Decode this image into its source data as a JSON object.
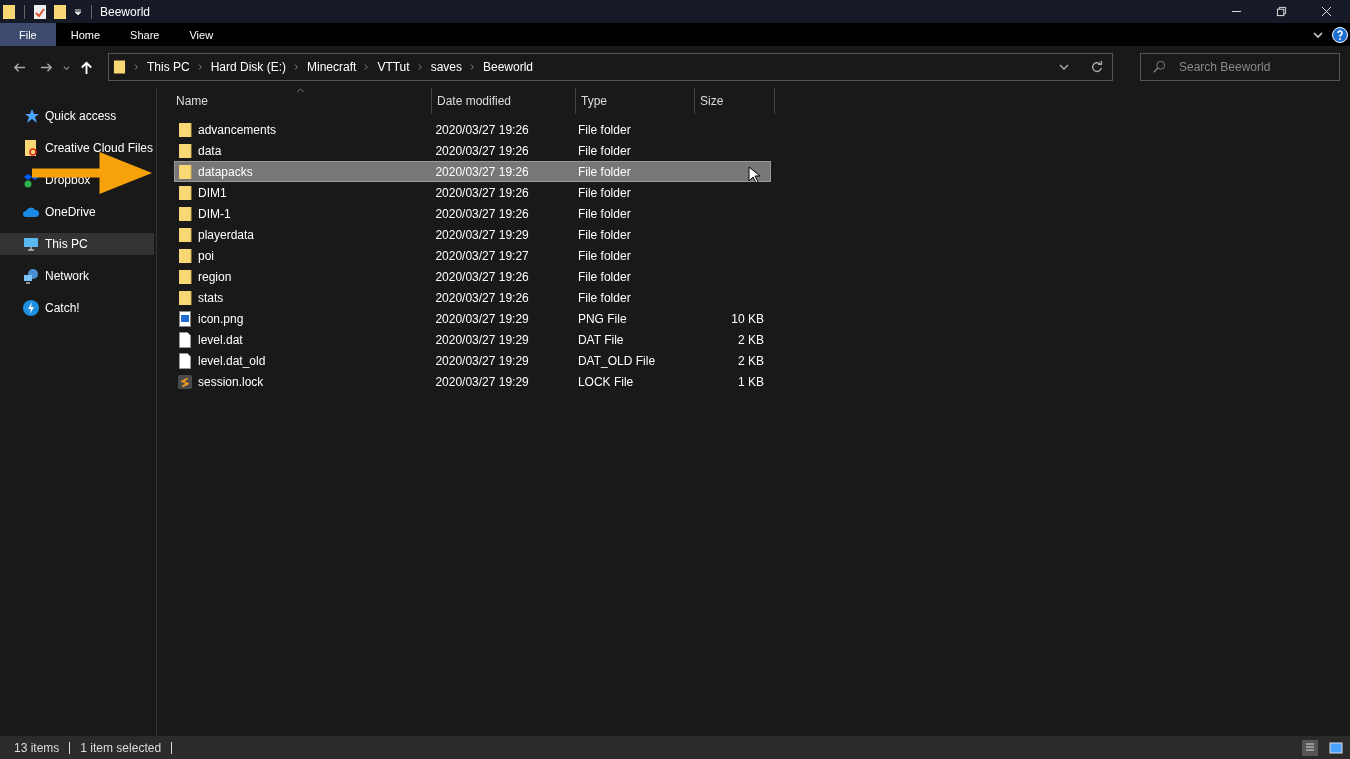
{
  "window": {
    "title": "Beeworld"
  },
  "ribbon_tabs": [
    {
      "label": "File",
      "selected": true
    },
    {
      "label": "Home",
      "selected": false
    },
    {
      "label": "Share",
      "selected": false
    },
    {
      "label": "View",
      "selected": false
    }
  ],
  "address": {
    "crumbs": [
      "This PC",
      "Hard Disk (E:)",
      "Minecraft",
      "VTTut",
      "saves",
      "Beeworld"
    ]
  },
  "search": {
    "placeholder": "Search Beeworld"
  },
  "sidebar": {
    "items": [
      {
        "label": "Quick access",
        "kind": "star",
        "selected": false
      },
      {
        "label": "Creative Cloud Files",
        "kind": "cloud-folder",
        "selected": false
      },
      {
        "label": "Dropbox",
        "kind": "dropbox",
        "selected": false
      },
      {
        "label": "OneDrive",
        "kind": "onedrive",
        "selected": false
      },
      {
        "label": "This PC",
        "kind": "pc",
        "selected": true
      },
      {
        "label": "Network",
        "kind": "network",
        "selected": false
      },
      {
        "label": "Catch!",
        "kind": "bolt",
        "selected": false
      }
    ]
  },
  "table": {
    "columns": [
      "Name",
      "Date modified",
      "Type",
      "Size"
    ],
    "rows": [
      {
        "name": "advancements",
        "date": "2020/03/27 19:26",
        "type": "File folder",
        "kind": "folder",
        "selected": false
      },
      {
        "name": "data",
        "date": "2020/03/27 19:26",
        "type": "File folder",
        "kind": "folder",
        "selected": false
      },
      {
        "name": "datapacks",
        "date": "2020/03/27 19:26",
        "type": "File folder",
        "kind": "folder",
        "selected": true
      },
      {
        "name": "DIM1",
        "date": "2020/03/27 19:26",
        "type": "File folder",
        "kind": "folder",
        "selected": false
      },
      {
        "name": "DIM-1",
        "date": "2020/03/27 19:26",
        "type": "File folder",
        "kind": "folder",
        "selected": false
      },
      {
        "name": "playerdata",
        "date": "2020/03/27 19:29",
        "type": "File folder",
        "kind": "folder",
        "selected": false
      },
      {
        "name": "poi",
        "date": "2020/03/27 19:27",
        "type": "File folder",
        "kind": "folder",
        "selected": false
      },
      {
        "name": "region",
        "date": "2020/03/27 19:26",
        "type": "File folder",
        "kind": "folder",
        "selected": false
      },
      {
        "name": "stats",
        "date": "2020/03/27 19:26",
        "type": "File folder",
        "kind": "folder",
        "selected": false
      },
      {
        "name": "icon.png",
        "date": "2020/03/27 19:29",
        "type": "PNG File",
        "size": "10 KB",
        "kind": "image",
        "selected": false
      },
      {
        "name": "level.dat",
        "date": "2020/03/27 19:29",
        "type": "DAT File",
        "size": "2 KB",
        "kind": "file",
        "selected": false
      },
      {
        "name": "level.dat_old",
        "date": "2020/03/27 19:29",
        "type": "DAT_OLD File",
        "size": "2 KB",
        "kind": "file",
        "selected": false
      },
      {
        "name": "session.lock",
        "date": "2020/03/27 19:29",
        "type": "LOCK File",
        "size": "1 KB",
        "kind": "script",
        "selected": false
      }
    ]
  },
  "status_bar": {
    "count": "13 items",
    "selection": "1 item selected"
  }
}
